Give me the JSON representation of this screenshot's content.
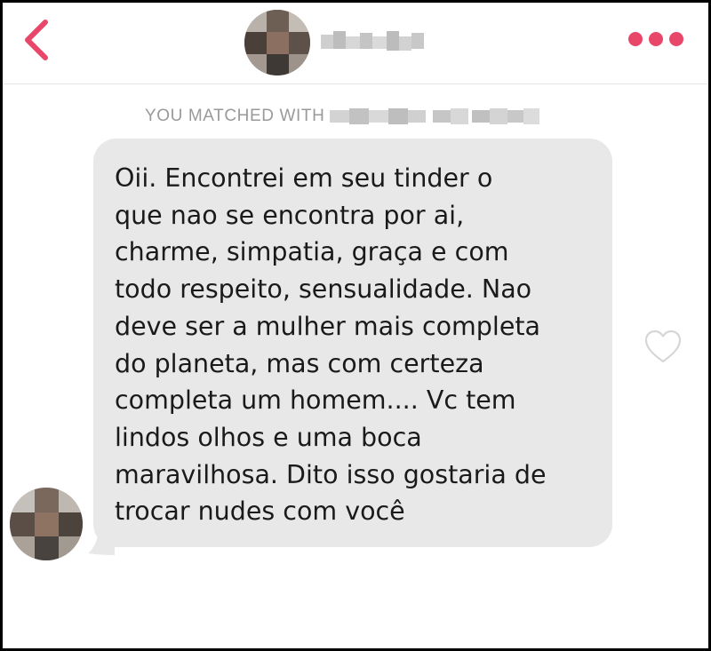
{
  "header": {
    "back_icon": "chevron-left-icon",
    "menu_icon": "more-dots-icon",
    "accent_color": "#e8476a"
  },
  "match": {
    "label": "YOU MATCHED WITH"
  },
  "message": {
    "text": "Oii.  Encontrei em seu tinder o\nque nao se encontra por ai,\ncharme, simpatia, graça e com\ntodo respeito, sensualidade. Nao\ndeve ser a mulher mais completa\ndo planeta, mas com certeza\ncompleta um homem.... Vc tem\nlindos olhos e uma boca\nmaravilhosa. Dito isso gostaria de\ntrocar nudes com você",
    "like_icon": "heart-outline-icon"
  }
}
